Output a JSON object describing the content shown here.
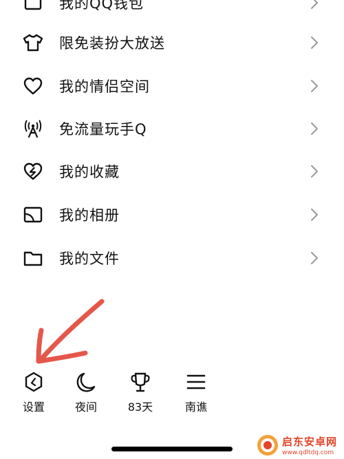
{
  "menu": {
    "items": [
      {
        "label": "我的QQ钱包",
        "icon": "wallet-icon"
      },
      {
        "label": "限免装扮大放送",
        "icon": "tshirt-icon"
      },
      {
        "label": "我的情侣空间",
        "icon": "heart-icon"
      },
      {
        "label": "免流量玩手Q",
        "icon": "signal-tower-icon"
      },
      {
        "label": "我的收藏",
        "icon": "favorite-heart-icon"
      },
      {
        "label": "我的相册",
        "icon": "album-icon"
      },
      {
        "label": "我的文件",
        "icon": "folder-icon"
      }
    ]
  },
  "bottom": {
    "settings": "设置",
    "night": "夜间",
    "days": "83天",
    "city": "南谯"
  },
  "watermark": {
    "title": "启东安卓网",
    "url": "www.qdltdq.com"
  },
  "colors": {
    "annotation_arrow": "#e5574a",
    "watermark": "#e2452b"
  }
}
